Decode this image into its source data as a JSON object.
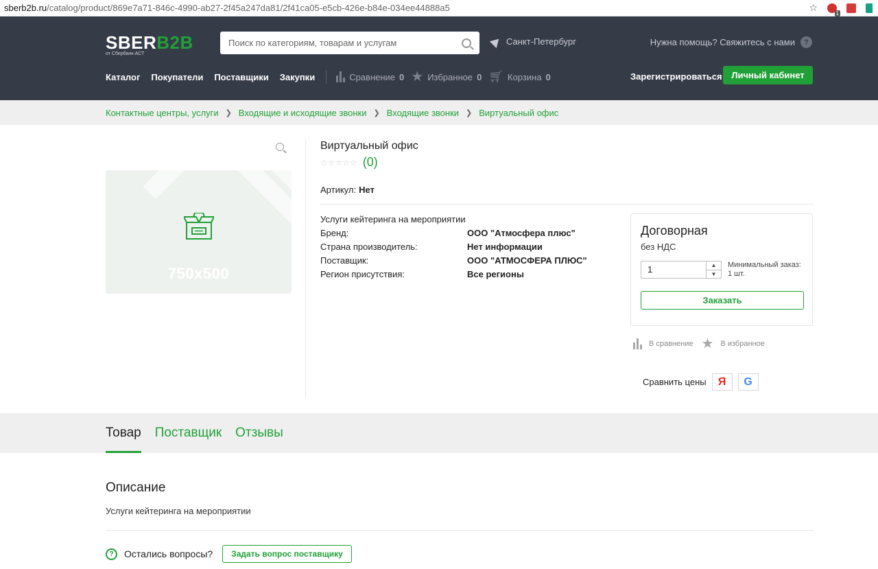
{
  "browser": {
    "url_host": "sberb2b.ru",
    "url_path": "/catalog/product/869e7a71-846c-4990-ab27-2f45a247da81/2f41ca05-e5cb-426e-b84e-034ee44888a5",
    "ext_badge": "1"
  },
  "header": {
    "logo_main": "SBER",
    "logo_accent": "B2B",
    "logo_sub": "от Сбербанк-АСТ",
    "search_placeholder": "Поиск по категориям, товарам и услугам",
    "city": "Санкт-Петербург",
    "help": "Нужна помощь? Свяжитесь с нами",
    "help_icon": "?",
    "nav": [
      "Каталог",
      "Покупатели",
      "Поставщики",
      "Закупки"
    ],
    "compare_label": "Сравнение",
    "compare_count": "0",
    "favorites_label": "Избранное",
    "favorites_count": "0",
    "cart_label": "Корзина",
    "cart_count": "0",
    "register": "Зарегистрироваться",
    "cabinet": "Личный кабинет"
  },
  "breadcrumbs": [
    "Контактные центры, услуги",
    "Входящие и исходящие звонки",
    "Входящие звонки",
    "Виртуальный офис"
  ],
  "product": {
    "image_placeholder": "750x500",
    "title": "Виртуальный офис",
    "stars": "☆☆☆☆☆",
    "rating_count": "(0)",
    "sku_label": "Артикул:",
    "sku_value": "Нет",
    "category": "Услуги кейтеринга на мероприятии",
    "specs": [
      {
        "key": "Бренд:",
        "value": "ООО \"Атмосфера плюс\""
      },
      {
        "key": "Страна производитель:",
        "value": "Нет информации"
      },
      {
        "key": "Поставщик:",
        "value": "ООО \"АТМОСФЕРА ПЛЮС\""
      },
      {
        "key": "Регион присутствия:",
        "value": "Все регионы"
      }
    ],
    "price": "Договорная",
    "vat": "без НДС",
    "quantity": "1",
    "min_order": "Минимальный заказ: 1 шт.",
    "order_button": "Заказать",
    "to_compare": "В сравнение",
    "to_favorites": "В избранное",
    "compare_prices": "Сравнить цены",
    "yandex": "Я",
    "google": "G"
  },
  "tabs": [
    "Товар",
    "Поставщик",
    "Отзывы"
  ],
  "description": {
    "heading": "Описание",
    "text": "Услуги кейтеринга на мероприятии",
    "questions": "Остались вопросы?",
    "ask_button": "Задать вопрос поставщику",
    "question_icon": "?"
  },
  "colors": {
    "accent": "#21a038",
    "header_bg": "#363b48"
  }
}
